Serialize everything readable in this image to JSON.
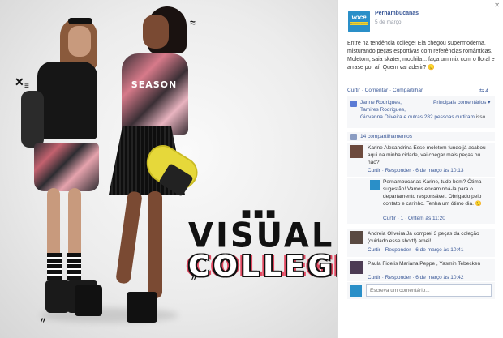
{
  "photo": {
    "headline_dots": "■■■",
    "headline_line1": "VISUAL",
    "headline_line2": "COLLEGE",
    "model_shirt_text": "SEASON"
  },
  "post": {
    "page_name": "Pernambucanas",
    "logo_text": "você",
    "logo_subtext": "Pernambucanas",
    "date": "5 de março",
    "text": "Entre na tendência college! Ela chegou supermoderna, misturando peças esportivas com referências românticas. Moletom, saia skater, mochila... faça um mix com o floral e arrase por aí! Quem vai aderir? 🙂",
    "actions": [
      "Curtir",
      "Comentar",
      "Compartilhar"
    ],
    "share_count": "4"
  },
  "feedback": {
    "sort_label": "Principais comentários ▾",
    "likers_line1": "Janne Rodrigues,",
    "likers_line2": "Tamires Rodrigues,",
    "likers_line3": "Giovanna Oliveira e outras 282 pessoas curtiram",
    "likers_line4": "isso.",
    "shares": "14 compartilhamentos"
  },
  "comments": [
    {
      "text": "Karine Alexandrina Esse moletom fundo já acabou aqui na minha cidade, vai chegar mais peças ou não?",
      "meta": "Curtir · Responder · 6 de março às 10:13"
    },
    {
      "text": "Pernambucanas Karine, tudo bem? Ótima sugestão! Vamos encaminhá-la para o departamento responsável. Obrigado pelo contato e carinho. Tenha um ótimo dia. 🙂",
      "meta": "Curtir · 1 · Ontem às 11:20"
    },
    {
      "text": "Andreia Oliveira Já comprei 3 peças da coleção (cuidado esse short!) amei!",
      "meta": "Curtir · Responder · 6 de março às 10:41"
    },
    {
      "text": "Paula Fidelis Mariana Peppe , Yasmin Tebecken",
      "meta": "Curtir · Responder · 6 de março às 10:42"
    }
  ],
  "comment_box": {
    "placeholder": "Escreva um comentário..."
  },
  "colors": {
    "brand_blue": "#3b5998",
    "logo_blue": "#2a8fc8",
    "logo_yellow": "#f3d22b"
  }
}
